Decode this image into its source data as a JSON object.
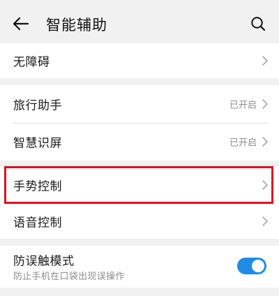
{
  "header": {
    "title": "智能辅助",
    "back_icon": "arrow-left-icon",
    "search_icon": "search-icon"
  },
  "sections": [
    {
      "items": [
        {
          "label": "无障碍",
          "status": "",
          "icon": "chevron-right-icon"
        }
      ]
    },
    {
      "items": [
        {
          "label": "旅行助手",
          "status": "已开启",
          "icon": "chevron-right-icon"
        },
        {
          "label": "智慧识屏",
          "status": "已开启",
          "icon": "chevron-right-icon"
        }
      ]
    },
    {
      "items": [
        {
          "label": "手势控制",
          "status": "",
          "icon": "chevron-right-icon",
          "highlighted": true
        },
        {
          "label": "语音控制",
          "status": "",
          "icon": "chevron-right-icon"
        }
      ]
    },
    {
      "items": [
        {
          "label": "防误触模式",
          "sublabel": "防止手机在口袋出现误操作",
          "toggle": true
        }
      ]
    }
  ],
  "colors": {
    "background": "#f1f1f1",
    "card": "#ffffff",
    "highlight_border": "#e10f1f",
    "toggle_on": "#1f8ce6",
    "secondary_text": "#8c8c8c"
  }
}
